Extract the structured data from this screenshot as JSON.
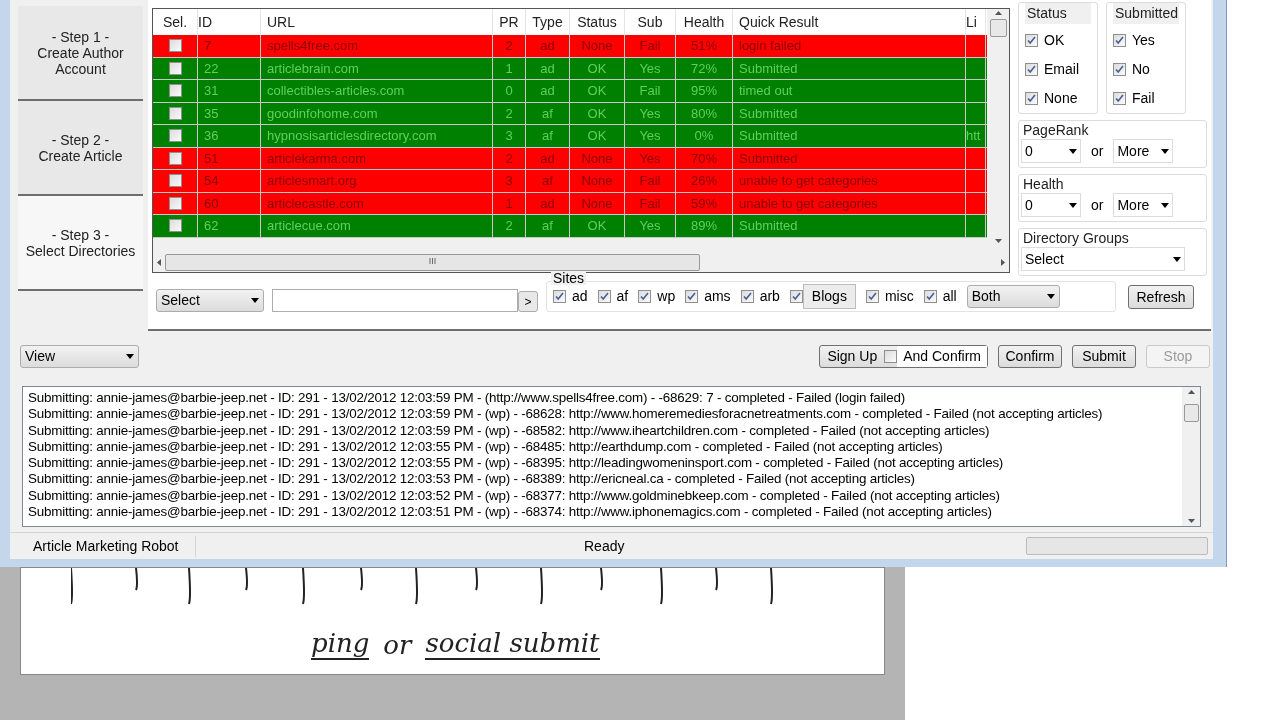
{
  "steps": [
    {
      "label": "- Step 1 -\nCreate Author Account",
      "selected": false
    },
    {
      "label": "- Step 2 -\nCreate Article",
      "selected": false
    },
    {
      "label": "- Step 3 -\nSelect Directories",
      "selected": true
    }
  ],
  "table": {
    "columns": [
      "Sel.",
      "ID",
      "URL",
      "PR",
      "Type",
      "Status",
      "Sub",
      "Health",
      "Quick Result",
      "Li"
    ],
    "rows": [
      {
        "ok": false,
        "checked": false,
        "cells": [
          "",
          "7",
          "spells4free.com",
          "2",
          "ad",
          "None",
          "Fail",
          "51%",
          "login failed",
          ""
        ]
      },
      {
        "ok": true,
        "checked": false,
        "cells": [
          "",
          "22",
          "articlebrain.com",
          "1",
          "ad",
          "OK",
          "Yes",
          "72%",
          "Submitted",
          ""
        ]
      },
      {
        "ok": true,
        "checked": false,
        "cells": [
          "",
          "31",
          "collectibles-articles.com",
          "0",
          "ad",
          "OK",
          "Fail",
          "95%",
          "timed out",
          ""
        ]
      },
      {
        "ok": true,
        "checked": false,
        "cells": [
          "",
          "35",
          "goodinfohome.com",
          "2",
          "af",
          "OK",
          "Yes",
          "80%",
          "Submitted",
          ""
        ]
      },
      {
        "ok": true,
        "checked": false,
        "cells": [
          "",
          "36",
          "hypnosisarticlesdirectory.com",
          "3",
          "af",
          "OK",
          "Yes",
          "0%",
          "Submitted",
          "htt"
        ]
      },
      {
        "ok": false,
        "checked": false,
        "cells": [
          "",
          "51",
          "articlekarma.com",
          "2",
          "ad",
          "None",
          "Yes",
          "70%",
          "Submitted",
          ""
        ]
      },
      {
        "ok": false,
        "checked": false,
        "cells": [
          "",
          "54",
          "articlesmart.org",
          "3",
          "af",
          "None",
          "Fail",
          "26%",
          "unable to get categories",
          ""
        ]
      },
      {
        "ok": false,
        "checked": false,
        "cells": [
          "",
          "60",
          "articlecastle.com",
          "1",
          "ad",
          "None",
          "Fail",
          "59%",
          "unable to get categories",
          ""
        ]
      },
      {
        "ok": true,
        "checked": false,
        "cells": [
          "",
          "62",
          "articlecue.com",
          "2",
          "af",
          "OK",
          "Yes",
          "89%",
          "Submitted",
          ""
        ]
      }
    ],
    "hscroll_label": "III"
  },
  "filters": {
    "status": {
      "title": "Status",
      "items": [
        {
          "label": "OK",
          "checked": true
        },
        {
          "label": "Email",
          "checked": true
        },
        {
          "label": "None",
          "checked": true
        }
      ]
    },
    "submitted": {
      "title": "Submitted",
      "items": [
        {
          "label": "Yes",
          "checked": true
        },
        {
          "label": "No",
          "checked": true
        },
        {
          "label": "Fail",
          "checked": true
        }
      ]
    },
    "pagerank": {
      "title": "PageRank",
      "from": "0",
      "or": "or",
      "to": "More"
    },
    "health": {
      "title": "Health",
      "from": "0",
      "or": "or",
      "to": "More"
    },
    "groups": {
      "title": "Directory Groups",
      "value": "Select"
    }
  },
  "search": {
    "select": "Select",
    "go": ">"
  },
  "sites": {
    "title": "Sites",
    "items": [
      {
        "kind": "check",
        "label": "ad",
        "checked": true
      },
      {
        "kind": "check",
        "label": "af",
        "checked": true
      },
      {
        "kind": "check",
        "label": "wp",
        "checked": true
      },
      {
        "kind": "check",
        "label": "ams",
        "checked": true
      },
      {
        "kind": "check",
        "label": "arb",
        "checked": true
      },
      {
        "kind": "boxed",
        "label": "Blogs",
        "checked": true
      },
      {
        "kind": "check",
        "label": "misc",
        "checked": true
      },
      {
        "kind": "check",
        "label": "all",
        "checked": true
      }
    ],
    "mode": "Both"
  },
  "refresh": "Refresh",
  "view": "View",
  "actions": {
    "signup": "Sign Up",
    "and_confirm": {
      "label": "And Confirm",
      "checked": false
    },
    "confirm": "Confirm",
    "submit": "Submit",
    "stop": {
      "label": "Stop",
      "disabled": true
    }
  },
  "log": [
    "Submitting: annie-james@barbie-jeep.net - ID: 291 - 13/02/2012 12:03:59 PM - (http://www.spells4free.com) - -68629: 7 - completed - Failed (login failed)",
    "Submitting: annie-james@barbie-jeep.net - ID: 291 - 13/02/2012 12:03:59 PM - (wp) - -68628: http://www.homeremediesforacnetreatments.com - completed - Failed (not accepting articles)",
    "Submitting: annie-james@barbie-jeep.net - ID: 291 - 13/02/2012 12:03:59 PM - (wp) - -68582: http://www.iheartchildren.com - completed - Failed (not accepting articles)",
    "Submitting: annie-james@barbie-jeep.net - ID: 291 - 13/02/2012 12:03:55 PM - (wp) - -68485: http://earthdump.com - completed - Failed (not accepting articles)",
    "Submitting: annie-james@barbie-jeep.net - ID: 291 - 13/02/2012 12:03:55 PM - (wp) - -68395: http://leadingwomeninsport.com - completed - Failed (not accepting articles)",
    "Submitting: annie-james@barbie-jeep.net - ID: 291 - 13/02/2012 12:03:53 PM - (wp) - -68389: http://ericneal.ca - completed - Failed (not accepting articles)",
    "Submitting: annie-james@barbie-jeep.net - ID: 291 - 13/02/2012 12:03:52 PM - (wp) - -68377: http://www.goldminebkeep.com - completed - Failed (not accepting articles)",
    "Submitting: annie-james@barbie-jeep.net - ID: 291 - 13/02/2012 12:03:51 PM - (wp) - -68374: http://www.iphonemagics.com - completed - Failed (not accepting articles)"
  ],
  "status_bar": {
    "app": "Article Marketing Robot",
    "status": "Ready"
  },
  "whiteboard": {
    "words": [
      "ping",
      "or",
      "social submit"
    ]
  }
}
